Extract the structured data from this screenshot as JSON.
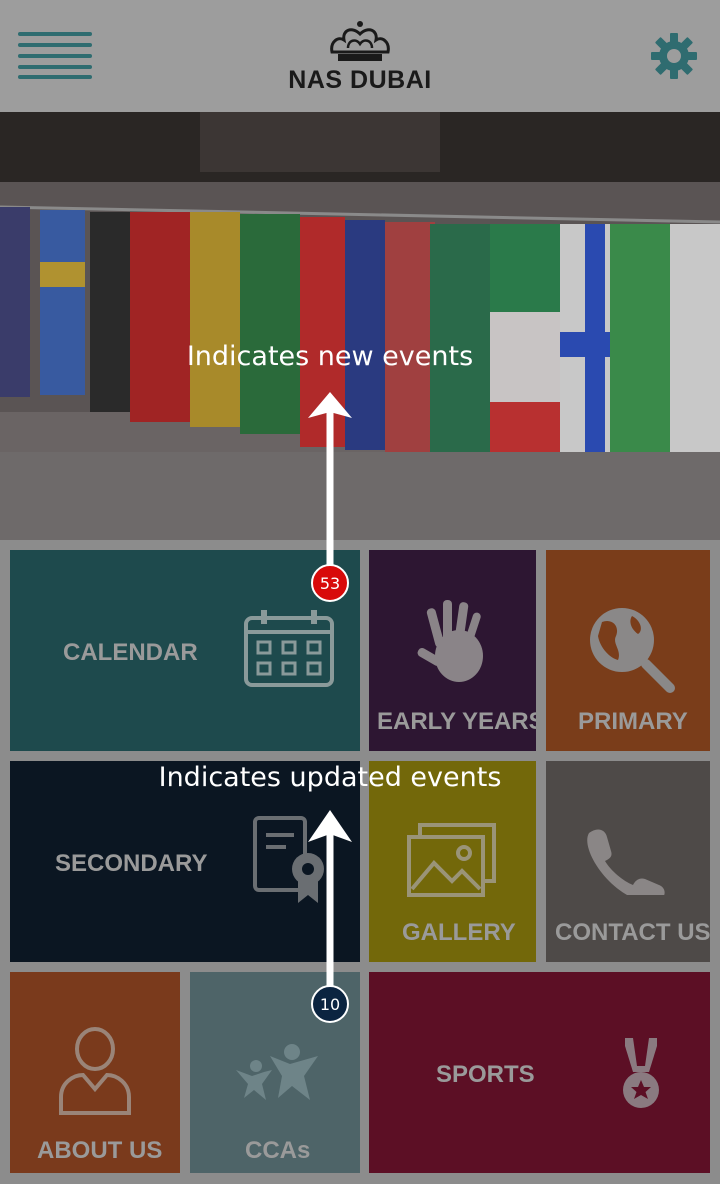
{
  "header": {
    "logo_text": "NAS DUBAI",
    "menu_icon": "hamburger-menu-icon",
    "settings_icon": "gear-icon"
  },
  "tiles": {
    "calendar": {
      "label": "CALENDAR",
      "icon": "calendar-icon",
      "color": "#1e4a4d"
    },
    "early_years": {
      "label": "EARLY YEARS",
      "icon": "hand-print-icon",
      "color": "#2d1632"
    },
    "primary": {
      "label": "PRIMARY",
      "icon": "globe-magnifier-icon",
      "color": "#7a3d1a"
    },
    "secondary": {
      "label": "SECONDARY",
      "icon": "certificate-icon",
      "color": "#0b1622"
    },
    "gallery": {
      "label": "GALLERY",
      "icon": "image-gallery-icon",
      "color": "#73680a"
    },
    "contact": {
      "label": "CONTACT US",
      "icon": "phone-icon",
      "color": "#4e4a48"
    },
    "about": {
      "label": "ABOUT US",
      "icon": "user-icon",
      "color": "#7a3a1c"
    },
    "ccas": {
      "label": "CCAs",
      "icon": "people-stars-icon",
      "color": "#4e6468"
    },
    "sports": {
      "label": "SPORTS",
      "icon": "medal-icon",
      "color": "#5c0f25"
    }
  },
  "badges": {
    "new_events": "53",
    "updated_events": "10"
  },
  "annotations": {
    "new_events": "Indicates new events",
    "updated_events": "Indicates updated events"
  }
}
